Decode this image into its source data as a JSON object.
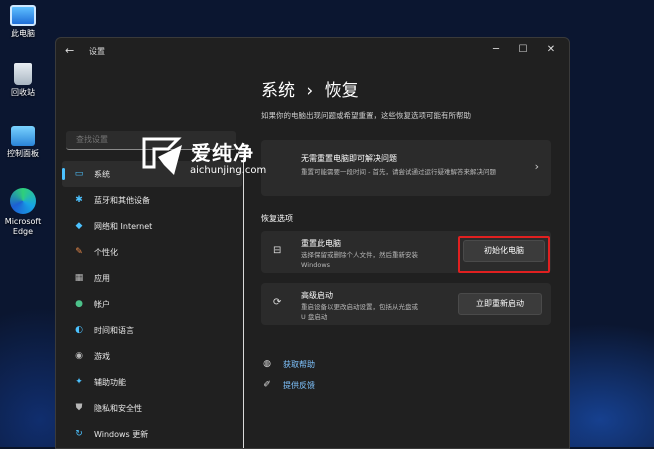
{
  "desktop": {
    "icons": [
      {
        "label": "此电脑",
        "icon": "computer-icon"
      },
      {
        "label": "回收站",
        "icon": "recycle-bin-icon"
      },
      {
        "label": "控制面板",
        "icon": "control-panel-icon"
      },
      {
        "label": "Microsoft Edge",
        "icon": "edge-icon"
      }
    ]
  },
  "window": {
    "title": "设置",
    "back_icon": "back-arrow-icon",
    "controls": {
      "minimize": "─",
      "maximize": "☐",
      "close": "✕"
    }
  },
  "search": {
    "placeholder": "查找设置"
  },
  "sidebar": {
    "items": [
      {
        "label": "系统",
        "icon": "system-icon",
        "color": "#4cc2ff",
        "active": true
      },
      {
        "label": "蓝牙和其他设备",
        "icon": "bluetooth-icon",
        "color": "#4cc2ff"
      },
      {
        "label": "网络和 Internet",
        "icon": "network-icon",
        "color": "#4cc2ff"
      },
      {
        "label": "个性化",
        "icon": "personalization-icon",
        "color": "#e8894a"
      },
      {
        "label": "应用",
        "icon": "apps-icon",
        "color": "#b7b7b7"
      },
      {
        "label": "帐户",
        "icon": "accounts-icon",
        "color": "#4cc28a"
      },
      {
        "label": "时间和语言",
        "icon": "time-language-icon",
        "color": "#4cc2ff"
      },
      {
        "label": "游戏",
        "icon": "gaming-icon",
        "color": "#b7b7b7"
      },
      {
        "label": "辅助功能",
        "icon": "accessibility-icon",
        "color": "#4cc2ff"
      },
      {
        "label": "隐私和安全性",
        "icon": "privacy-icon",
        "color": "#b7b7b7"
      },
      {
        "label": "Windows 更新",
        "icon": "windows-update-icon",
        "color": "#4cc2ff"
      }
    ]
  },
  "main": {
    "breadcrumb_parent": "系统",
    "breadcrumb_sep": "›",
    "breadcrumb_current": "恢复",
    "description": "如果你的电脑出现问题或希望重置，这些恢复选项可能有所帮助",
    "troubleshoot_card": {
      "title": "无需重置电脑即可解决问题",
      "subtitle": "重置可能需要一段时间 - 首先，请尝试通过运行疑难解答来解决问题"
    },
    "section_title": "恢复选项",
    "reset_card": {
      "title": "重置此电脑",
      "subtitle_line1": "选择保留或删除个人文件，然后重新安装",
      "subtitle_line2": "Windows",
      "button": "初始化电脑"
    },
    "advanced_card": {
      "title": "高级启动",
      "subtitle_line1": "重启设备以更改启动设置，包括从光盘或",
      "subtitle_line2": "U 盘启动",
      "button": "立即重新启动"
    },
    "links": [
      {
        "label": "获取帮助",
        "icon": "help-icon"
      },
      {
        "label": "提供反馈",
        "icon": "feedback-icon"
      }
    ]
  },
  "watermark": {
    "brand": "爱纯净",
    "url": "aichunjing.com"
  }
}
